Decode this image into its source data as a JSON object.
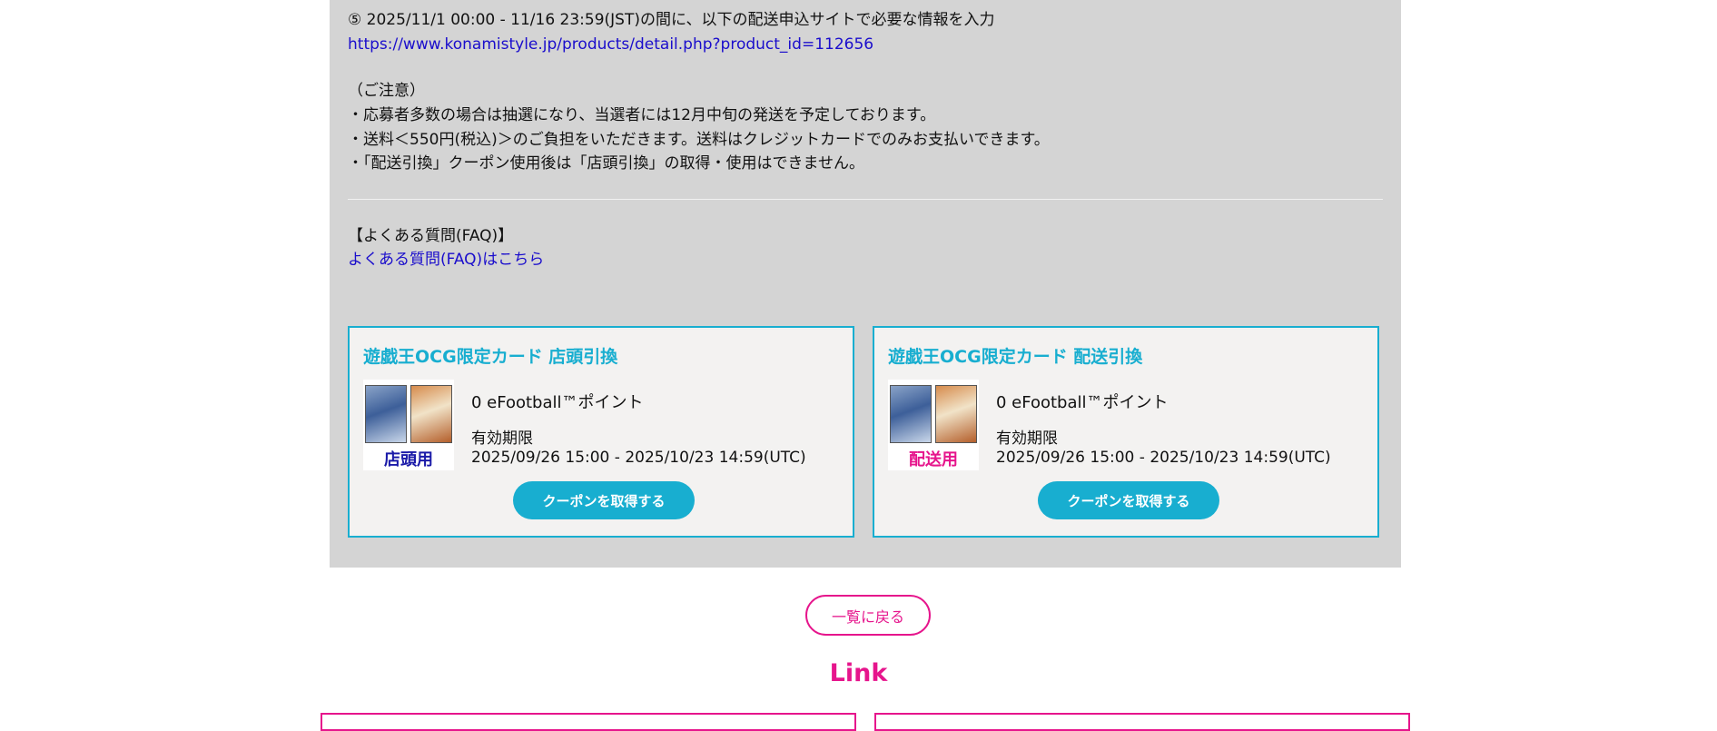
{
  "notice": {
    "step5": "⑤ 2025/11/1 00:00 - 11/16 23:59(JST)の間に、以下の配送申込サイトで必要な情報を入力",
    "url": "https://www.konamistyle.jp/products/detail.php?product_id=112656",
    "caution_heading": "（ご注意）",
    "caution_items": [
      "・応募者多数の場合は抽選になり、当選者には12月中旬の発送を予定しております。",
      "・送料＜550円(税込)＞のご負担をいただきます。送料はクレジットカードでのみお支払いできます。",
      "・「配送引換」クーポン使用後は「店頭引換」の取得・使用はできません。"
    ]
  },
  "faq": {
    "heading": "【よくある質問(FAQ)】",
    "link": "よくある質問(FAQ)はこちら"
  },
  "coupons": [
    {
      "title": "遊戯王OCG限定カード 店頭引換",
      "thumb_label": "店頭用",
      "thumb_label_color": "#1a1aa8",
      "points": "0 eFootball™ポイント",
      "expiry_label": "有効期限",
      "expiry": "2025/09/26 15:00 - 2025/10/23 14:59(UTC)",
      "button": "クーポンを取得する"
    },
    {
      "title": "遊戯王OCG限定カード 配送引換",
      "thumb_label": "配送用",
      "thumb_label_color": "#e6158c",
      "points": "0 eFootball™ポイント",
      "expiry_label": "有効期限",
      "expiry": "2025/09/26 15:00 - 2025/10/23 14:59(UTC)",
      "button": "クーポンを取得する"
    }
  ],
  "back_button": "一覧に戻る",
  "link_heading": "Link",
  "colors": {
    "accent_blue": "#18aed0",
    "accent_pink": "#e6158c",
    "panel_gray": "#d4d4d4",
    "link_blue": "#1a0dcc"
  }
}
